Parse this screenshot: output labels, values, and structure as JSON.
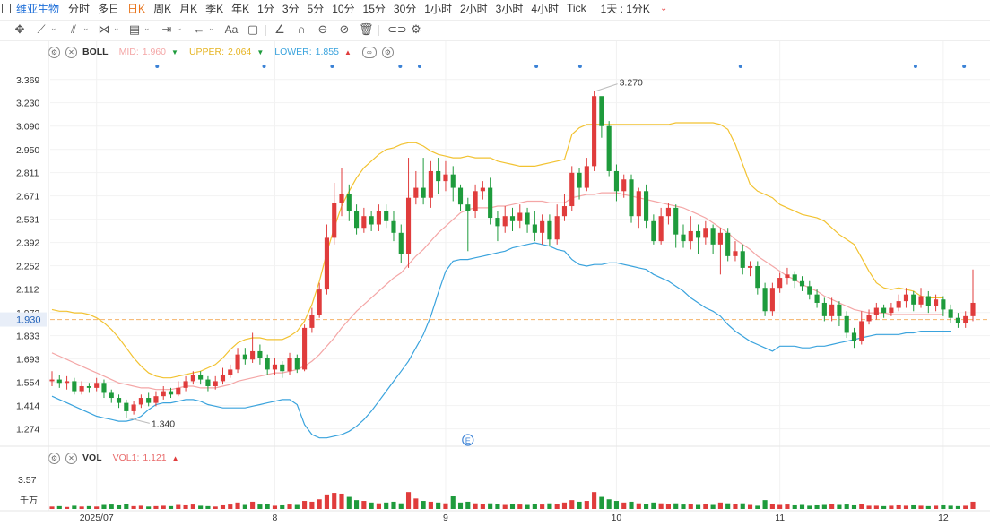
{
  "header": {
    "stock_name": "维亚生物",
    "timeframes": [
      "分时",
      "多日",
      "日K",
      "周K",
      "月K",
      "季K",
      "年K",
      "1分",
      "3分",
      "5分",
      "10分",
      "15分",
      "30分",
      "1小时",
      "2小时",
      "3小时",
      "4小时",
      "Tick",
      "1天 : 1分K"
    ],
    "active_timeframe": "日K"
  },
  "toolbar": {
    "icons": [
      "crosshair-icon",
      "line-tool-icon",
      "channel-tool-icon",
      "pattern-tool-icon",
      "fib-tool-icon",
      "measure-tool-icon",
      "arrow-tool-icon",
      "text-tool-icon",
      "note-tool-icon",
      "ruler-icon",
      "magnet-icon",
      "lock-icon",
      "hide-icon",
      "trash-icon",
      "link-icon",
      "settings-icon"
    ],
    "text_tool_label": "Aa"
  },
  "boll_legend": {
    "name": "BOLL",
    "mid_label": "MID:",
    "mid_value": "1.960",
    "upper_label": "UPPER:",
    "upper_value": "2.064",
    "lower_label": "LOWER:",
    "lower_value": "1.855",
    "colors": {
      "mid": "#f4a6a6",
      "upper": "#f2c230",
      "lower": "#3aa3dd"
    }
  },
  "vol_legend": {
    "name": "VOL",
    "vol1_label": "VOL1:",
    "vol1_value": "1.121",
    "color": "#e86a6a"
  },
  "chart_data": {
    "type": "candlestick",
    "y_ticks": [
      "3.369",
      "3.230",
      "3.090",
      "2.950",
      "2.811",
      "2.671",
      "2.531",
      "2.392",
      "2.252",
      "2.112",
      "1.972",
      "1.833",
      "1.693",
      "1.554",
      "1.414",
      "1.274"
    ],
    "ylim": [
      1.17,
      3.47
    ],
    "x_labels": [
      {
        "label": "2025/07",
        "index": 6
      },
      {
        "label": "8",
        "index": 30
      },
      {
        "label": "9",
        "index": 53
      },
      {
        "label": "10",
        "index": 76
      },
      {
        "label": "11",
        "index": 98
      },
      {
        "label": "12",
        "index": 120
      }
    ],
    "current_price": "1.930",
    "high_annotation": "3.270",
    "low_annotation": "1.340",
    "event_marker": "E",
    "vol_y_tick": "3.57",
    "vol_unit": "千万",
    "colors": {
      "up": "#e03c3c",
      "down": "#1e9b3c",
      "price_line": "#f5b36a"
    },
    "candles": [
      [
        1.56,
        1.57,
        1.62,
        1.53
      ],
      [
        1.57,
        1.55,
        1.6,
        1.52
      ],
      [
        1.55,
        1.56,
        1.59,
        1.51
      ],
      [
        1.56,
        1.5,
        1.58,
        1.48
      ],
      [
        1.5,
        1.53,
        1.56,
        1.48
      ],
      [
        1.53,
        1.52,
        1.55,
        1.49
      ],
      [
        1.52,
        1.55,
        1.58,
        1.5
      ],
      [
        1.55,
        1.49,
        1.57,
        1.46
      ],
      [
        1.49,
        1.46,
        1.51,
        1.43
      ],
      [
        1.46,
        1.43,
        1.48,
        1.4
      ],
      [
        1.43,
        1.38,
        1.45,
        1.34
      ],
      [
        1.38,
        1.42,
        1.44,
        1.36
      ],
      [
        1.42,
        1.46,
        1.48,
        1.4
      ],
      [
        1.46,
        1.43,
        1.49,
        1.41
      ],
      [
        1.43,
        1.47,
        1.5,
        1.41
      ],
      [
        1.47,
        1.5,
        1.53,
        1.45
      ],
      [
        1.5,
        1.48,
        1.52,
        1.46
      ],
      [
        1.48,
        1.52,
        1.56,
        1.47
      ],
      [
        1.52,
        1.56,
        1.59,
        1.5
      ],
      [
        1.56,
        1.6,
        1.62,
        1.54
      ],
      [
        1.6,
        1.57,
        1.62,
        1.54
      ],
      [
        1.57,
        1.53,
        1.59,
        1.5
      ],
      [
        1.53,
        1.56,
        1.59,
        1.51
      ],
      [
        1.56,
        1.6,
        1.64,
        1.54
      ],
      [
        1.6,
        1.63,
        1.66,
        1.58
      ],
      [
        1.63,
        1.72,
        1.76,
        1.61
      ],
      [
        1.72,
        1.69,
        1.76,
        1.66
      ],
      [
        1.69,
        1.74,
        1.85,
        1.67
      ],
      [
        1.74,
        1.7,
        1.78,
        1.66
      ],
      [
        1.7,
        1.63,
        1.72,
        1.6
      ],
      [
        1.63,
        1.66,
        1.7,
        1.6
      ],
      [
        1.66,
        1.62,
        1.68,
        1.58
      ],
      [
        1.62,
        1.7,
        1.73,
        1.6
      ],
      [
        1.7,
        1.63,
        1.72,
        1.61
      ],
      [
        1.63,
        1.88,
        1.9,
        1.62
      ],
      [
        1.88,
        1.96,
        2.0,
        1.85
      ],
      [
        1.96,
        2.11,
        2.15,
        1.94
      ],
      [
        2.11,
        2.42,
        2.5,
        2.08
      ],
      [
        2.42,
        2.63,
        2.75,
        2.38
      ],
      [
        2.63,
        2.68,
        2.84,
        2.55
      ],
      [
        2.68,
        2.58,
        2.74,
        2.52
      ],
      [
        2.58,
        2.48,
        2.62,
        2.44
      ],
      [
        2.48,
        2.55,
        2.6,
        2.45
      ],
      [
        2.55,
        2.5,
        2.58,
        2.46
      ],
      [
        2.5,
        2.58,
        2.62,
        2.46
      ],
      [
        2.58,
        2.52,
        2.62,
        2.48
      ],
      [
        2.52,
        2.45,
        2.58,
        2.4
      ],
      [
        2.45,
        2.32,
        2.5,
        2.27
      ],
      [
        2.32,
        2.66,
        2.9,
        2.24
      ],
      [
        2.66,
        2.72,
        2.82,
        2.62
      ],
      [
        2.72,
        2.66,
        2.9,
        2.62
      ],
      [
        2.66,
        2.82,
        2.88,
        2.6
      ],
      [
        2.82,
        2.76,
        2.9,
        2.68
      ],
      [
        2.76,
        2.8,
        2.88,
        2.7
      ],
      [
        2.8,
        2.72,
        2.85,
        2.64
      ],
      [
        2.72,
        2.62,
        2.74,
        2.58
      ],
      [
        2.62,
        2.58,
        2.66,
        2.34
      ],
      [
        2.58,
        2.7,
        2.74,
        2.54
      ],
      [
        2.7,
        2.72,
        2.76,
        2.65
      ],
      [
        2.72,
        2.54,
        2.78,
        2.5
      ],
      [
        2.54,
        2.49,
        2.58,
        2.4
      ],
      [
        2.49,
        2.55,
        2.61,
        2.45
      ],
      [
        2.55,
        2.52,
        2.6,
        2.46
      ],
      [
        2.52,
        2.57,
        2.62,
        2.48
      ],
      [
        2.57,
        2.5,
        2.6,
        2.45
      ],
      [
        2.5,
        2.45,
        2.58,
        2.4
      ],
      [
        2.45,
        2.52,
        2.56,
        2.38
      ],
      [
        2.52,
        2.41,
        2.56,
        2.37
      ],
      [
        2.41,
        2.55,
        2.62,
        2.38
      ],
      [
        2.55,
        2.61,
        2.68,
        2.52
      ],
      [
        2.61,
        2.81,
        2.85,
        2.58
      ],
      [
        2.81,
        2.72,
        2.84,
        2.65
      ],
      [
        2.72,
        2.85,
        2.9,
        2.7
      ],
      [
        2.85,
        3.27,
        3.3,
        2.82
      ],
      [
        3.27,
        3.09,
        3.24,
        3.02
      ],
      [
        3.09,
        2.82,
        3.12,
        2.79
      ],
      [
        2.82,
        2.7,
        2.86,
        2.64
      ],
      [
        2.7,
        2.77,
        2.8,
        2.66
      ],
      [
        2.77,
        2.55,
        2.8,
        2.51
      ],
      [
        2.55,
        2.7,
        2.72,
        2.48
      ],
      [
        2.7,
        2.52,
        2.74,
        2.48
      ],
      [
        2.52,
        2.4,
        2.56,
        2.38
      ],
      [
        2.4,
        2.55,
        2.6,
        2.38
      ],
      [
        2.55,
        2.6,
        2.63,
        2.5
      ],
      [
        2.6,
        2.44,
        2.62,
        2.36
      ],
      [
        2.44,
        2.4,
        2.5,
        2.36
      ],
      [
        2.4,
        2.46,
        2.55,
        2.35
      ],
      [
        2.46,
        2.42,
        2.5,
        2.32
      ],
      [
        2.42,
        2.48,
        2.52,
        2.38
      ],
      [
        2.48,
        2.38,
        2.5,
        2.32
      ],
      [
        2.38,
        2.45,
        2.48,
        2.2
      ],
      [
        2.45,
        2.31,
        2.48,
        2.28
      ],
      [
        2.31,
        2.34,
        2.4,
        2.28
      ],
      [
        2.34,
        2.24,
        2.38,
        2.2
      ],
      [
        2.24,
        2.25,
        2.28,
        2.19
      ],
      [
        2.25,
        2.12,
        2.28,
        2.08
      ],
      [
        2.12,
        1.98,
        2.15,
        1.95
      ],
      [
        1.98,
        2.12,
        2.15,
        1.95
      ],
      [
        2.12,
        2.18,
        2.21,
        2.09
      ],
      [
        2.18,
        2.2,
        2.24,
        2.14
      ],
      [
        2.2,
        2.16,
        2.22,
        2.12
      ],
      [
        2.16,
        2.13,
        2.19,
        2.1
      ],
      [
        2.13,
        2.08,
        2.16,
        2.05
      ],
      [
        2.08,
        2.03,
        2.11,
        2.0
      ],
      [
        2.03,
        1.95,
        2.06,
        1.92
      ],
      [
        1.95,
        2.02,
        2.06,
        1.92
      ],
      [
        2.02,
        1.95,
        2.04,
        1.89
      ],
      [
        1.95,
        1.85,
        1.98,
        1.82
      ],
      [
        1.85,
        1.8,
        1.88,
        1.76
      ],
      [
        1.8,
        1.92,
        1.98,
        1.78
      ],
      [
        1.92,
        1.96,
        1.99,
        1.9
      ],
      [
        1.96,
        2.0,
        2.03,
        1.93
      ],
      [
        2.0,
        1.97,
        2.02,
        1.94
      ],
      [
        1.97,
        2.0,
        2.03,
        1.95
      ],
      [
        2.0,
        2.04,
        2.08,
        1.98
      ],
      [
        2.04,
        2.08,
        2.12,
        2.0
      ],
      [
        2.08,
        2.02,
        2.1,
        1.98
      ],
      [
        2.02,
        2.07,
        2.12,
        2.0
      ],
      [
        2.07,
        2.01,
        2.1,
        1.97
      ],
      [
        2.01,
        2.05,
        2.08,
        1.98
      ],
      [
        2.05,
        1.99,
        2.07,
        1.95
      ],
      [
        1.99,
        1.94,
        2.02,
        1.91
      ],
      [
        1.94,
        1.91,
        1.97,
        1.88
      ],
      [
        1.91,
        1.95,
        1.98,
        1.88
      ],
      [
        1.95,
        2.03,
        2.23,
        1.92
      ]
    ],
    "upper": [
      1.99,
      1.98,
      1.98,
      1.97,
      1.97,
      1.96,
      1.94,
      1.91,
      1.87,
      1.82,
      1.76,
      1.7,
      1.65,
      1.61,
      1.59,
      1.58,
      1.58,
      1.59,
      1.6,
      1.61,
      1.62,
      1.64,
      1.66,
      1.7,
      1.75,
      1.79,
      1.81,
      1.82,
      1.82,
      1.81,
      1.81,
      1.81,
      1.83,
      1.86,
      1.92,
      2.02,
      2.16,
      2.33,
      2.48,
      2.61,
      2.7,
      2.78,
      2.84,
      2.88,
      2.92,
      2.95,
      2.96,
      2.98,
      2.99,
      2.99,
      2.97,
      2.94,
      2.92,
      2.91,
      2.9,
      2.9,
      2.91,
      2.9,
      2.9,
      2.9,
      2.88,
      2.87,
      2.86,
      2.85,
      2.85,
      2.85,
      2.86,
      2.87,
      2.88,
      2.89,
      3.04,
      3.08,
      3.1,
      3.1,
      3.1,
      3.1,
      3.1,
      3.1,
      3.1,
      3.1,
      3.1,
      3.1,
      3.1,
      3.1,
      3.11,
      3.11,
      3.11,
      3.11,
      3.11,
      3.11,
      3.1,
      3.07,
      2.98,
      2.86,
      2.74,
      2.7,
      2.68,
      2.66,
      2.62,
      2.6,
      2.58,
      2.56,
      2.55,
      2.54,
      2.52,
      2.48,
      2.44,
      2.41,
      2.38,
      2.3,
      2.22,
      2.15,
      2.12,
      2.11,
      2.12,
      2.11,
      2.1,
      2.07,
      2.06,
      2.06,
      2.06
    ],
    "mid": [
      1.73,
      1.71,
      1.69,
      1.67,
      1.65,
      1.63,
      1.61,
      1.59,
      1.57,
      1.55,
      1.54,
      1.53,
      1.52,
      1.52,
      1.51,
      1.51,
      1.51,
      1.52,
      1.53,
      1.53,
      1.52,
      1.52,
      1.52,
      1.53,
      1.54,
      1.56,
      1.57,
      1.58,
      1.59,
      1.6,
      1.61,
      1.61,
      1.62,
      1.63,
      1.65,
      1.68,
      1.72,
      1.77,
      1.82,
      1.88,
      1.93,
      1.98,
      2.02,
      2.06,
      2.1,
      2.14,
      2.18,
      2.21,
      2.26,
      2.31,
      2.35,
      2.4,
      2.45,
      2.49,
      2.53,
      2.57,
      2.59,
      2.6,
      2.6,
      2.6,
      2.61,
      2.61,
      2.62,
      2.63,
      2.64,
      2.64,
      2.64,
      2.63,
      2.63,
      2.63,
      2.66,
      2.67,
      2.68,
      2.68,
      2.69,
      2.69,
      2.69,
      2.68,
      2.67,
      2.66,
      2.65,
      2.64,
      2.63,
      2.62,
      2.61,
      2.6,
      2.58,
      2.56,
      2.54,
      2.51,
      2.48,
      2.45,
      2.41,
      2.38,
      2.35,
      2.31,
      2.28,
      2.25,
      2.22,
      2.19,
      2.17,
      2.14,
      2.12,
      2.1,
      2.07,
      2.05,
      2.03,
      2.01,
      1.99,
      1.98,
      1.97,
      1.97,
      1.97,
      1.96,
      1.96,
      1.96,
      1.96,
      1.96,
      1.96,
      1.96,
      1.96
    ],
    "lower": [
      1.47,
      1.45,
      1.43,
      1.41,
      1.39,
      1.37,
      1.35,
      1.34,
      1.33,
      1.32,
      1.32,
      1.33,
      1.35,
      1.39,
      1.42,
      1.43,
      1.43,
      1.44,
      1.45,
      1.45,
      1.44,
      1.42,
      1.41,
      1.4,
      1.4,
      1.4,
      1.4,
      1.41,
      1.42,
      1.43,
      1.44,
      1.45,
      1.45,
      1.42,
      1.3,
      1.24,
      1.22,
      1.22,
      1.23,
      1.24,
      1.26,
      1.29,
      1.33,
      1.38,
      1.44,
      1.5,
      1.56,
      1.62,
      1.68,
      1.76,
      1.84,
      1.95,
      2.09,
      2.22,
      2.28,
      2.29,
      2.29,
      2.3,
      2.31,
      2.32,
      2.33,
      2.34,
      2.36,
      2.37,
      2.38,
      2.39,
      2.38,
      2.37,
      2.35,
      2.34,
      2.29,
      2.26,
      2.25,
      2.26,
      2.26,
      2.27,
      2.27,
      2.26,
      2.25,
      2.24,
      2.23,
      2.2,
      2.18,
      2.16,
      2.13,
      2.1,
      2.06,
      2.03,
      2.0,
      1.98,
      1.95,
      1.9,
      1.86,
      1.83,
      1.8,
      1.78,
      1.76,
      1.74,
      1.77,
      1.77,
      1.77,
      1.76,
      1.76,
      1.77,
      1.77,
      1.78,
      1.79,
      1.8,
      1.81,
      1.82,
      1.83,
      1.84,
      1.84,
      1.84,
      1.84,
      1.85,
      1.85,
      1.86,
      1.86,
      1.86,
      1.86,
      1.86
    ],
    "volumes": [
      0.3,
      0.35,
      0.25,
      0.4,
      0.3,
      0.35,
      0.3,
      0.5,
      0.55,
      0.45,
      0.6,
      0.35,
      0.4,
      0.3,
      0.35,
      0.4,
      0.35,
      0.5,
      0.45,
      0.55,
      0.4,
      0.35,
      0.3,
      0.45,
      0.55,
      0.8,
      0.5,
      0.9,
      0.55,
      0.6,
      0.4,
      0.45,
      0.55,
      0.5,
      1.0,
      0.9,
      1.2,
      1.8,
      2.0,
      1.9,
      1.5,
      1.1,
      1.0,
      0.8,
      0.7,
      0.8,
      0.9,
      0.7,
      2.1,
      1.3,
      1.0,
      0.9,
      0.8,
      0.7,
      1.6,
      0.8,
      0.9,
      0.7,
      0.6,
      0.7,
      0.6,
      0.5,
      0.6,
      0.55,
      0.5,
      0.6,
      0.55,
      0.7,
      0.6,
      0.8,
      1.1,
      0.9,
      1.0,
      2.1,
      1.5,
      1.2,
      1.0,
      0.8,
      0.9,
      0.7,
      0.6,
      0.8,
      0.7,
      0.6,
      0.7,
      0.55,
      0.6,
      0.5,
      0.6,
      0.5,
      0.8,
      0.7,
      0.6,
      0.7,
      0.5,
      0.4,
      1.1,
      0.6,
      0.5,
      0.55,
      0.45,
      0.5,
      0.4,
      0.45,
      0.5,
      0.6,
      0.5,
      0.55,
      0.45,
      0.6,
      0.4,
      0.4,
      0.35,
      0.4,
      0.45,
      0.4,
      0.45,
      0.4,
      0.35,
      0.4,
      0.45,
      0.4,
      0.35,
      0.4,
      0.9
    ]
  }
}
